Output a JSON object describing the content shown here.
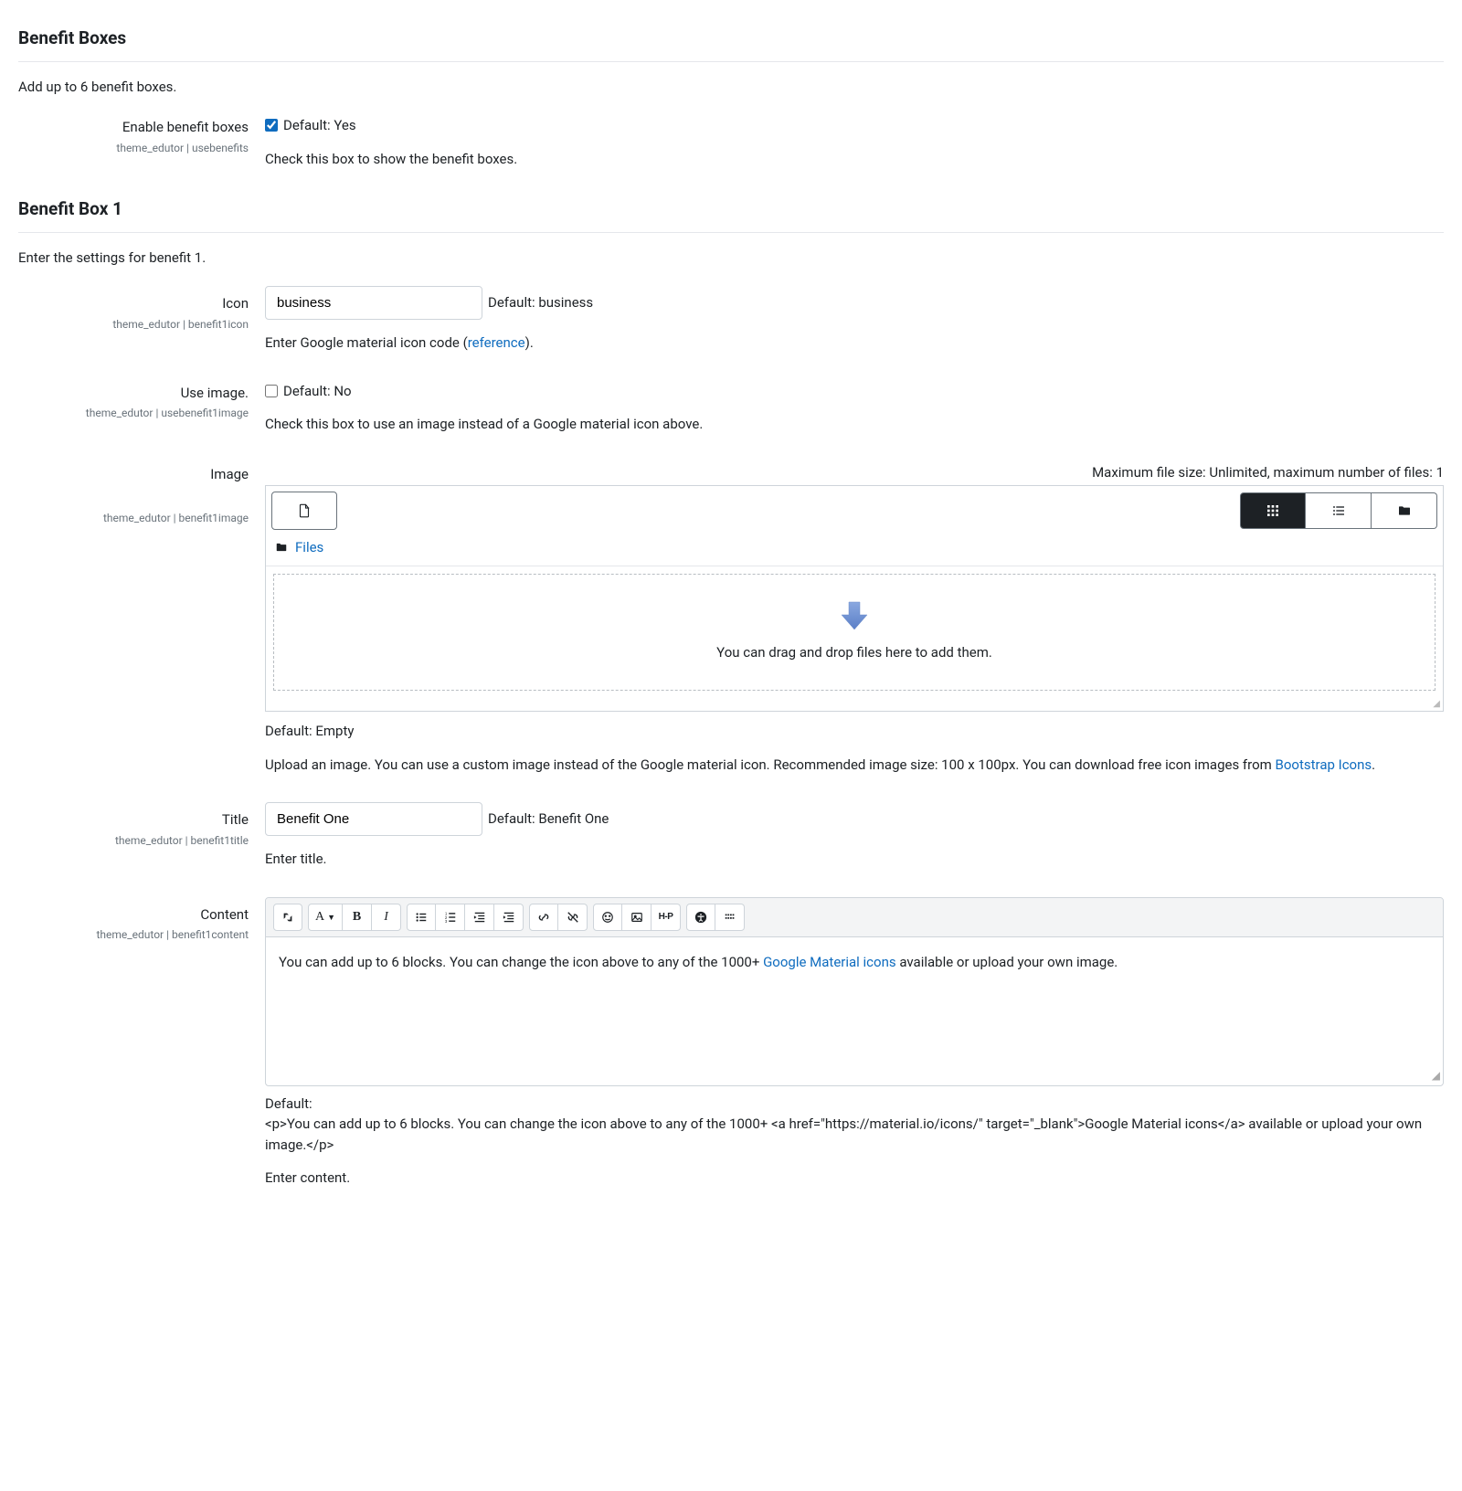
{
  "sections": {
    "benefit_boxes": {
      "title": "Benefit Boxes",
      "description": "Add up to 6 benefit boxes.",
      "enable": {
        "label": "Enable benefit boxes",
        "setting": "theme_edutor | usebenefits",
        "checked": true,
        "default_text": "Default: Yes",
        "desc": "Check this box to show the benefit boxes."
      }
    },
    "benefit_box_1": {
      "title": "Benefit Box 1",
      "description": "Enter the settings for benefit 1.",
      "icon": {
        "label": "Icon",
        "setting": "theme_edutor | benefit1icon",
        "value": "business",
        "default_text": "Default: business",
        "desc_prefix": "Enter Google material icon code (",
        "desc_link": "reference",
        "desc_suffix": ")."
      },
      "use_image": {
        "label": "Use image.",
        "setting": "theme_edutor | usebenefit1image",
        "checked": false,
        "default_text": "Default: No",
        "desc": "Check this box to use an image instead of a Google material icon above."
      },
      "image": {
        "label": "Image",
        "setting": "theme_edutor | benefit1image",
        "file_limit_text": "Maximum file size: Unlimited, maximum number of files: 1",
        "breadcrumb": "Files",
        "dropzone_text": "You can drag and drop files here to add them.",
        "default_text": "Default: Empty",
        "desc_prefix": "Upload an image. You can use a custom image instead of the Google material icon. Recommended image size: 100 x 100px. You can download free icon images from ",
        "desc_link": "Bootstrap Icons",
        "desc_suffix": "."
      },
      "title_field": {
        "label": "Title",
        "setting": "theme_edutor | benefit1title",
        "value": "Benefit One",
        "default_text": "Default: Benefit One",
        "desc": "Enter title."
      },
      "content": {
        "label": "Content",
        "setting": "theme_edutor | benefit1content",
        "body_prefix": "You can add up to 6 blocks. You can change the icon above to any of the 1000+ ",
        "body_link": "Google Material icons",
        "body_suffix": " available or upload your own image.",
        "default_label": "Default:",
        "default_html": "<p>You can add up to 6 blocks. You can change the icon above to any of the 1000+ <a href=\"https://material.io/icons/\" target=\"_blank\">Google Material icons</a> available or upload your own image.</p>",
        "desc": "Enter content."
      }
    }
  },
  "editor_toolbar": {
    "expand": "↓",
    "style": "A",
    "bold": "B",
    "italic": "I",
    "h5p": "H-P"
  }
}
